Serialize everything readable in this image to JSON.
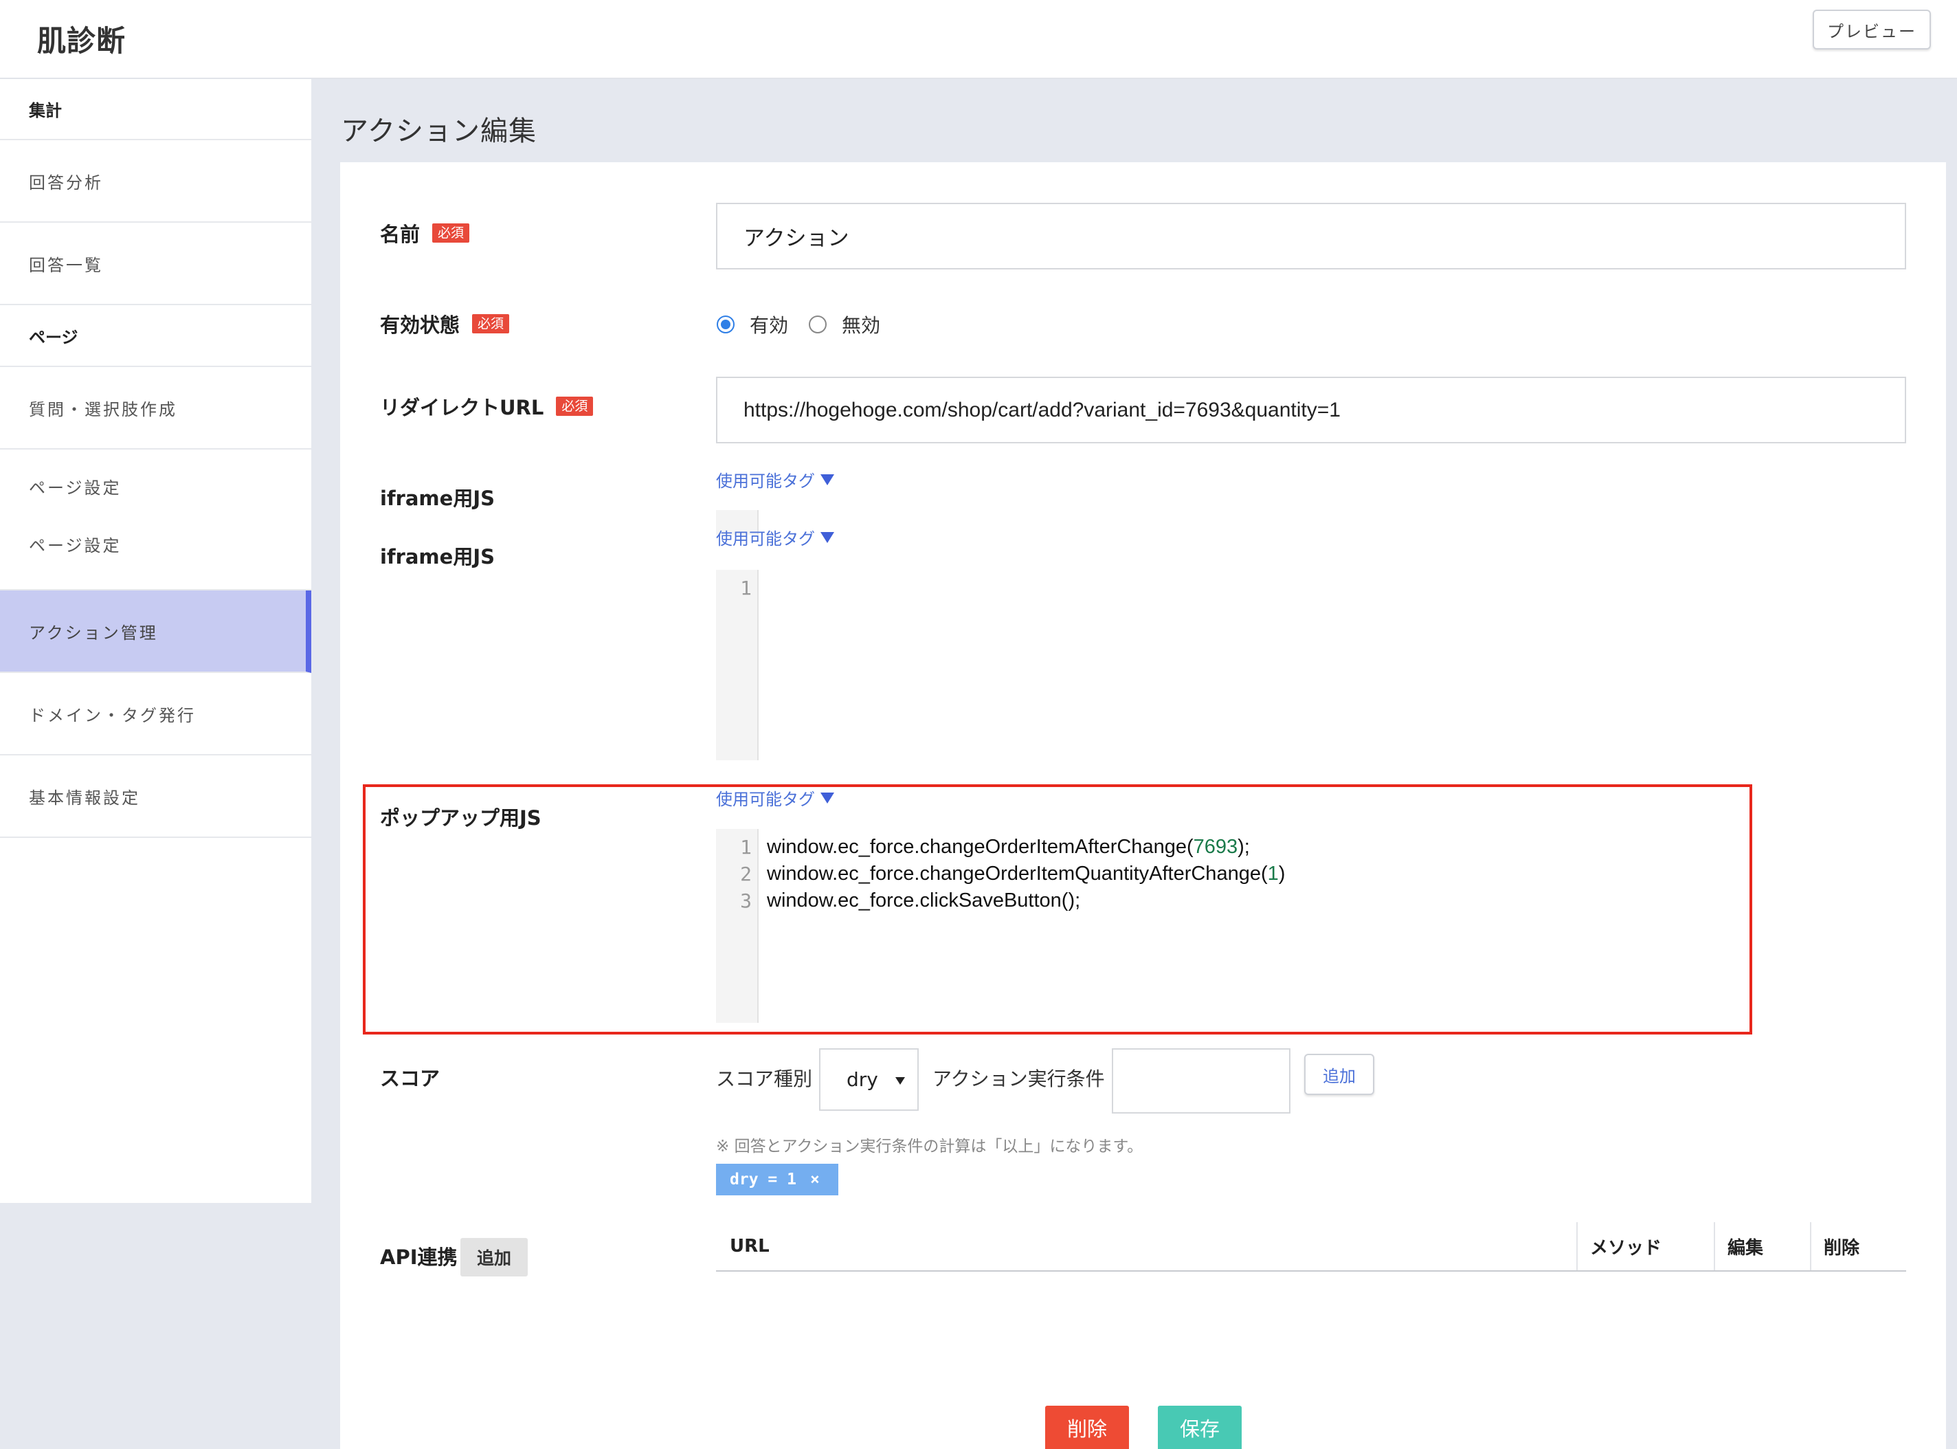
{
  "header": {
    "app_title": "肌診断",
    "preview_label": "プレビュー"
  },
  "sidebar": {
    "sections": [
      {
        "label": "集計"
      },
      {
        "label": "ページ"
      }
    ],
    "items": [
      {
        "label": "回答分析"
      },
      {
        "label": "回答一覧"
      },
      {
        "label": "質問・選択肢作成"
      },
      {
        "label": "ページ設定"
      },
      {
        "label": "ページ設定"
      },
      {
        "label": "アクション管理",
        "active": true
      },
      {
        "label": "ドメイン・タグ発行"
      },
      {
        "label": "基本情報設定"
      }
    ]
  },
  "main": {
    "page_title": "アクション編集",
    "required_badge": "必須",
    "name": {
      "label": "名前",
      "value": "アクション"
    },
    "status": {
      "label": "有効状態",
      "options": [
        "有効",
        "無効"
      ],
      "selected": "有効"
    },
    "redirect": {
      "label": "リダイレクトURL",
      "value": "https://hogehoge.com/shop/cart/add?variant_id=7693&quantity=1"
    },
    "available_tags": "使用可能タグ",
    "iframe_js_1": {
      "label": "iframe用JS",
      "line_numbers": [
        "1"
      ]
    },
    "iframe_js_2": {
      "label": "iframe用JS",
      "line_numbers": [
        "1"
      ]
    },
    "popup_js": {
      "label": "ポップアップ用JS",
      "lines": [
        {
          "num": "1",
          "pre": "window.ec_force.changeOrderItemAfterChange(",
          "arg": "7693",
          "post": ");"
        },
        {
          "num": "2",
          "pre": "window.ec_force.changeOrderItemQuantityAfterChange(",
          "arg": "1",
          "post": ")"
        },
        {
          "num": "3",
          "pre": "window.ec_force.clickSaveButton();",
          "arg": "",
          "post": ""
        }
      ]
    },
    "score": {
      "label": "スコア",
      "type_label": "スコア種別",
      "type_value": "dry",
      "condition_label": "アクション実行条件",
      "condition_value": "",
      "add_label": "追加",
      "note": "※ 回答とアクション実行条件の計算は「以上」になります。",
      "chip_text": "dry = 1",
      "chip_remove": "×"
    },
    "api": {
      "label": "API連携",
      "add_label": "追加",
      "columns": [
        "URL",
        "メソッド",
        "編集",
        "削除"
      ]
    },
    "delete_label": "削除",
    "save_label": "保存"
  }
}
